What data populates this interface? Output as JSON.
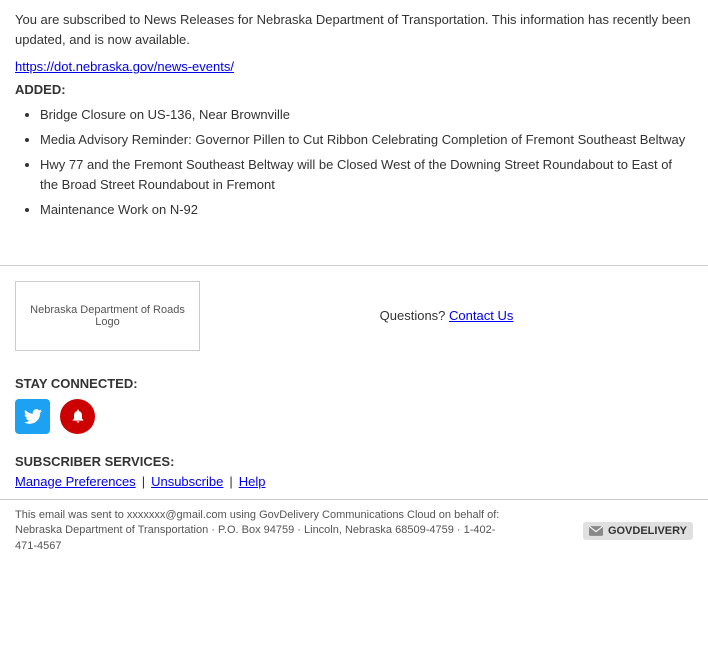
{
  "main": {
    "intro_text": "You are subscribed to News Releases for Nebraska Department of Transportation. This information has recently been updated, and is now available.",
    "link": {
      "text": "https://dot.nebraska.gov/news-events/",
      "href": "https://dot.nebraska.gov/news-events/"
    },
    "added_label": "ADDED:",
    "news_items": [
      "Bridge Closure on US-136, Near Brownville",
      "Media Advisory Reminder: Governor Pillen to Cut Ribbon Celebrating Completion of Fremont Southeast Beltway",
      "Hwy 77 and the Fremont Southeast Beltway will be Closed West of the Downing Street Roundabout to East of the Broad Street Roundabout in Fremont",
      "Maintenance Work on N-92"
    ]
  },
  "footer": {
    "logo_alt": "Nebraska Department of Roads Logo",
    "questions_text": "Questions?",
    "contact_link_text": "Contact Us",
    "stay_connected_label": "STAY CONNECTED:",
    "subscriber_services_label": "SUBSCRIBER SERVICES:",
    "manage_preferences_text": "Manage Preferences",
    "unsubscribe_text": "Unsubscribe",
    "help_text": "Help",
    "bottom_text": "This email was sent to xxxxxxx@gmail.com using GovDelivery Communications Cloud on behalf of: Nebraska Department of Transportation · P.O. Box 94759 · Lincoln, Nebraska 68509-4759 · 1-402-471-4567",
    "govdelivery_text": "GOVDELIVERY"
  }
}
